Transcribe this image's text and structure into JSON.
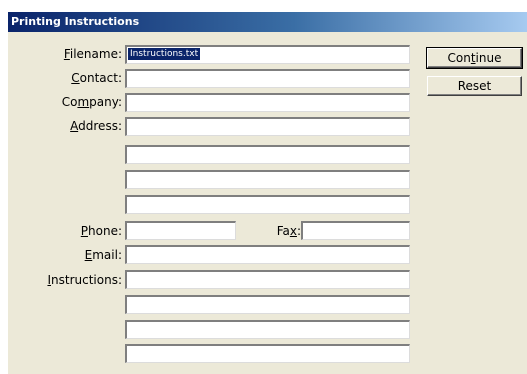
{
  "window": {
    "title": "Printing Instructions"
  },
  "form": {
    "filename": {
      "label_mnemonic": "F",
      "label_rest": "ilename:",
      "value": "Instructions.txt"
    },
    "contact": {
      "label_mnemonic": "C",
      "label_rest": "ontact:"
    },
    "company": {
      "label_pre": "Co",
      "label_mnemonic": "m",
      "label_rest": "pany:"
    },
    "address": {
      "label_mnemonic": "A",
      "label_rest": "ddress:"
    },
    "phone": {
      "label_mnemonic": "P",
      "label_rest": "hone:"
    },
    "fax": {
      "label_pre": "Fa",
      "label_mnemonic": "x",
      "label_rest": ":"
    },
    "email": {
      "label_mnemonic": "E",
      "label_rest": "mail:"
    },
    "instructions": {
      "label_mnemonic": "I",
      "label_rest": "nstructions:"
    }
  },
  "buttons": {
    "continue": {
      "pre": "Con",
      "mnemonic": "t",
      "rest": "inue"
    },
    "reset": {
      "label": "Reset"
    }
  }
}
